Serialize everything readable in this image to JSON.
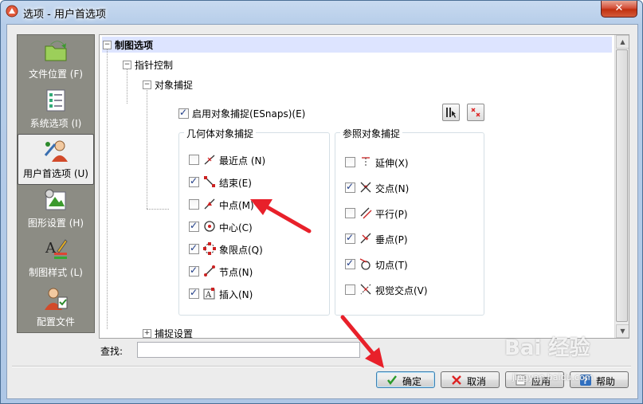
{
  "window": {
    "title": "选项 - 用户首选项",
    "close_glyph": "✕"
  },
  "sidebar": {
    "items": [
      {
        "label": "文件位置 (F)",
        "icon": "folder-arrow-icon"
      },
      {
        "label": "系统选项 (I)",
        "icon": "checklist-icon"
      },
      {
        "label": "用户首选项 (U)",
        "icon": "user-settings-icon",
        "active": true
      },
      {
        "label": "图形设置 (H)",
        "icon": "graphics-settings-icon"
      },
      {
        "label": "制图样式 (L)",
        "icon": "drafting-style-icon"
      },
      {
        "label": "配置文件",
        "icon": "profile-icon"
      }
    ]
  },
  "tree": {
    "root": "制图选项",
    "pointer_control": "指针控制",
    "object_snap": "对象捕捉",
    "enable_snap": "启用对象捕捉(ESnaps)(E)",
    "snap_settings": "捕捉设置",
    "geometric_group": {
      "title": "几何体对象捕捉",
      "items": [
        {
          "label": "最近点 (N)",
          "checked": false,
          "icon": "nearest-icon"
        },
        {
          "label": "结束(E)",
          "checked": true,
          "icon": "endpoint-icon"
        },
        {
          "label": "中点(M)",
          "checked": false,
          "icon": "midpoint-icon"
        },
        {
          "label": "中心(C)",
          "checked": true,
          "icon": "center-icon"
        },
        {
          "label": "象限点(Q)",
          "checked": true,
          "icon": "quadrant-icon"
        },
        {
          "label": "节点(N)",
          "checked": true,
          "icon": "node-icon"
        },
        {
          "label": "插入(N)",
          "checked": true,
          "icon": "insert-icon"
        }
      ]
    },
    "reference_group": {
      "title": "参照对象捕捉",
      "items": [
        {
          "label": "延伸(X)",
          "checked": false,
          "icon": "extension-icon"
        },
        {
          "label": "交点(N)",
          "checked": true,
          "icon": "intersection-icon"
        },
        {
          "label": "平行(P)",
          "checked": false,
          "icon": "parallel-icon"
        },
        {
          "label": "垂点(P)",
          "checked": true,
          "icon": "perpendicular-icon"
        },
        {
          "label": "切点(T)",
          "checked": true,
          "icon": "tangent-icon"
        },
        {
          "label": "视觉交点(V)",
          "checked": false,
          "icon": "apparent-intersection-icon"
        }
      ]
    }
  },
  "search": {
    "label": "查找:",
    "value": ""
  },
  "buttons": {
    "ok": "确定",
    "cancel": "取消",
    "apply": "应用",
    "help": "帮助"
  },
  "watermark": {
    "text": "Bai 经验",
    "url": "jingyan.baidu.com"
  },
  "colors": {
    "accent_arrow": "#e8202a",
    "active_item_bg": "#eeeeee",
    "sidebar_bg": "#8c8c84",
    "tree_header_bg": "#dde4ff"
  }
}
